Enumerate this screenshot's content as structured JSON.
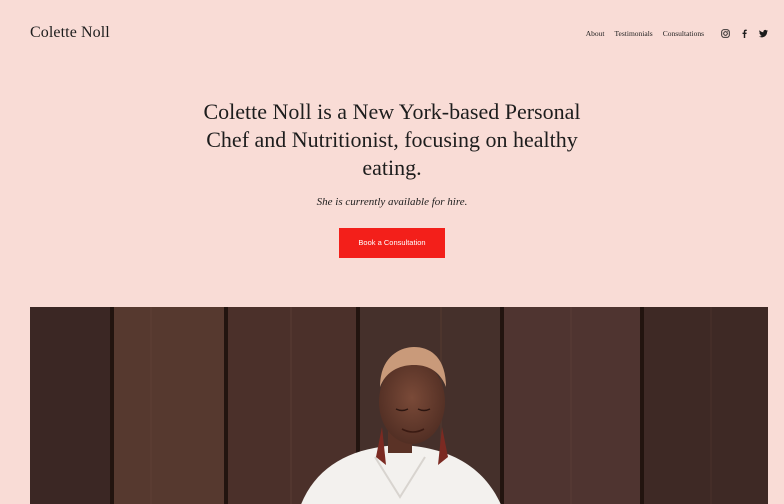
{
  "header": {
    "site_title": "Colette Noll",
    "nav": [
      {
        "label": "About"
      },
      {
        "label": "Testimonials"
      },
      {
        "label": "Consultations"
      }
    ],
    "social_icons": [
      "instagram-icon",
      "facebook-icon",
      "twitter-icon"
    ]
  },
  "hero": {
    "headline": "Colette Noll is a New York-based Personal Chef and Nutritionist, focusing on healthy eating.",
    "subline": "She is currently available for hire.",
    "cta_label": "Book a Consultation"
  },
  "colors": {
    "background": "#f9dcd6",
    "accent": "#f31f1a",
    "text": "#1d1d1d"
  }
}
